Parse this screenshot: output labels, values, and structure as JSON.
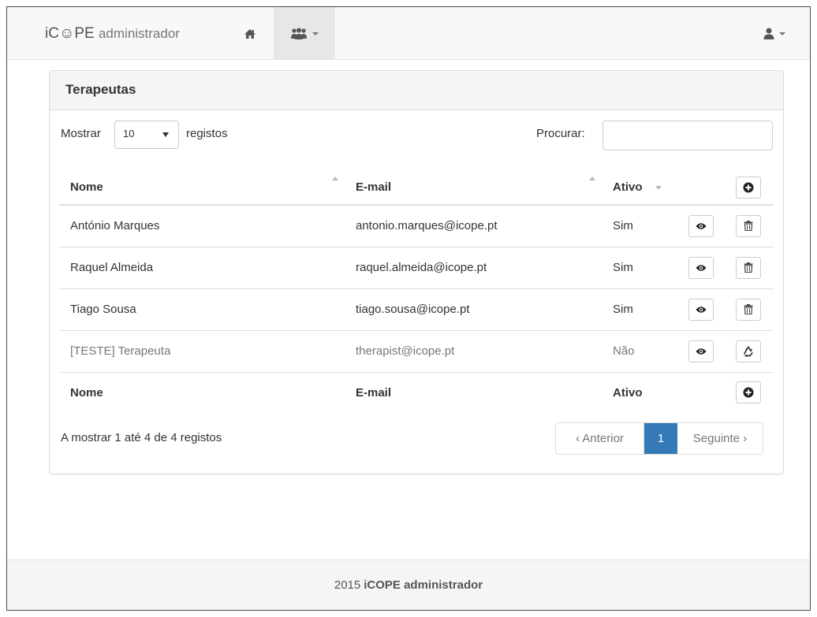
{
  "navbar": {
    "brand_main": "iC☺PE",
    "brand_sub": "administrador",
    "home_icon": "home-icon",
    "users_icon": "users-icon",
    "user_icon": "user-icon"
  },
  "panel": {
    "title": "Terapeutas",
    "length_label": "Mostrar",
    "length_value": "10",
    "length_suffix": "registos",
    "search_label": "Procurar:",
    "search_value": ""
  },
  "table": {
    "headers": {
      "name": "Nome",
      "email": "E-mail",
      "active": "Ativo"
    },
    "rows": [
      {
        "name": "António Marques",
        "email": "antonio.marques@icope.pt",
        "active": "Sim",
        "action_icon": "trash-icon"
      },
      {
        "name": "Raquel Almeida",
        "email": "raquel.almeida@icope.pt",
        "active": "Sim",
        "action_icon": "trash-icon"
      },
      {
        "name": "Tiago Sousa",
        "email": "tiago.sousa@icope.pt",
        "active": "Sim",
        "action_icon": "trash-icon"
      },
      {
        "name": "[TESTE] Terapeuta",
        "email": "therapist@icope.pt",
        "active": "Não",
        "action_icon": "recycle-icon"
      }
    ],
    "footers": {
      "name": "Nome",
      "email": "E-mail",
      "active": "Ativo"
    }
  },
  "info": "A mostrar 1 até 4 de 4 registos",
  "pagination": {
    "prev": "‹ Anterior",
    "current": "1",
    "next": "Seguinte ›"
  },
  "footer": {
    "year": "2015",
    "name": "iCOPE administrador"
  },
  "colors": {
    "accent": "#337ab7",
    "navbar_bg": "#f8f8f8",
    "panel_heading_bg": "#f5f5f5"
  }
}
